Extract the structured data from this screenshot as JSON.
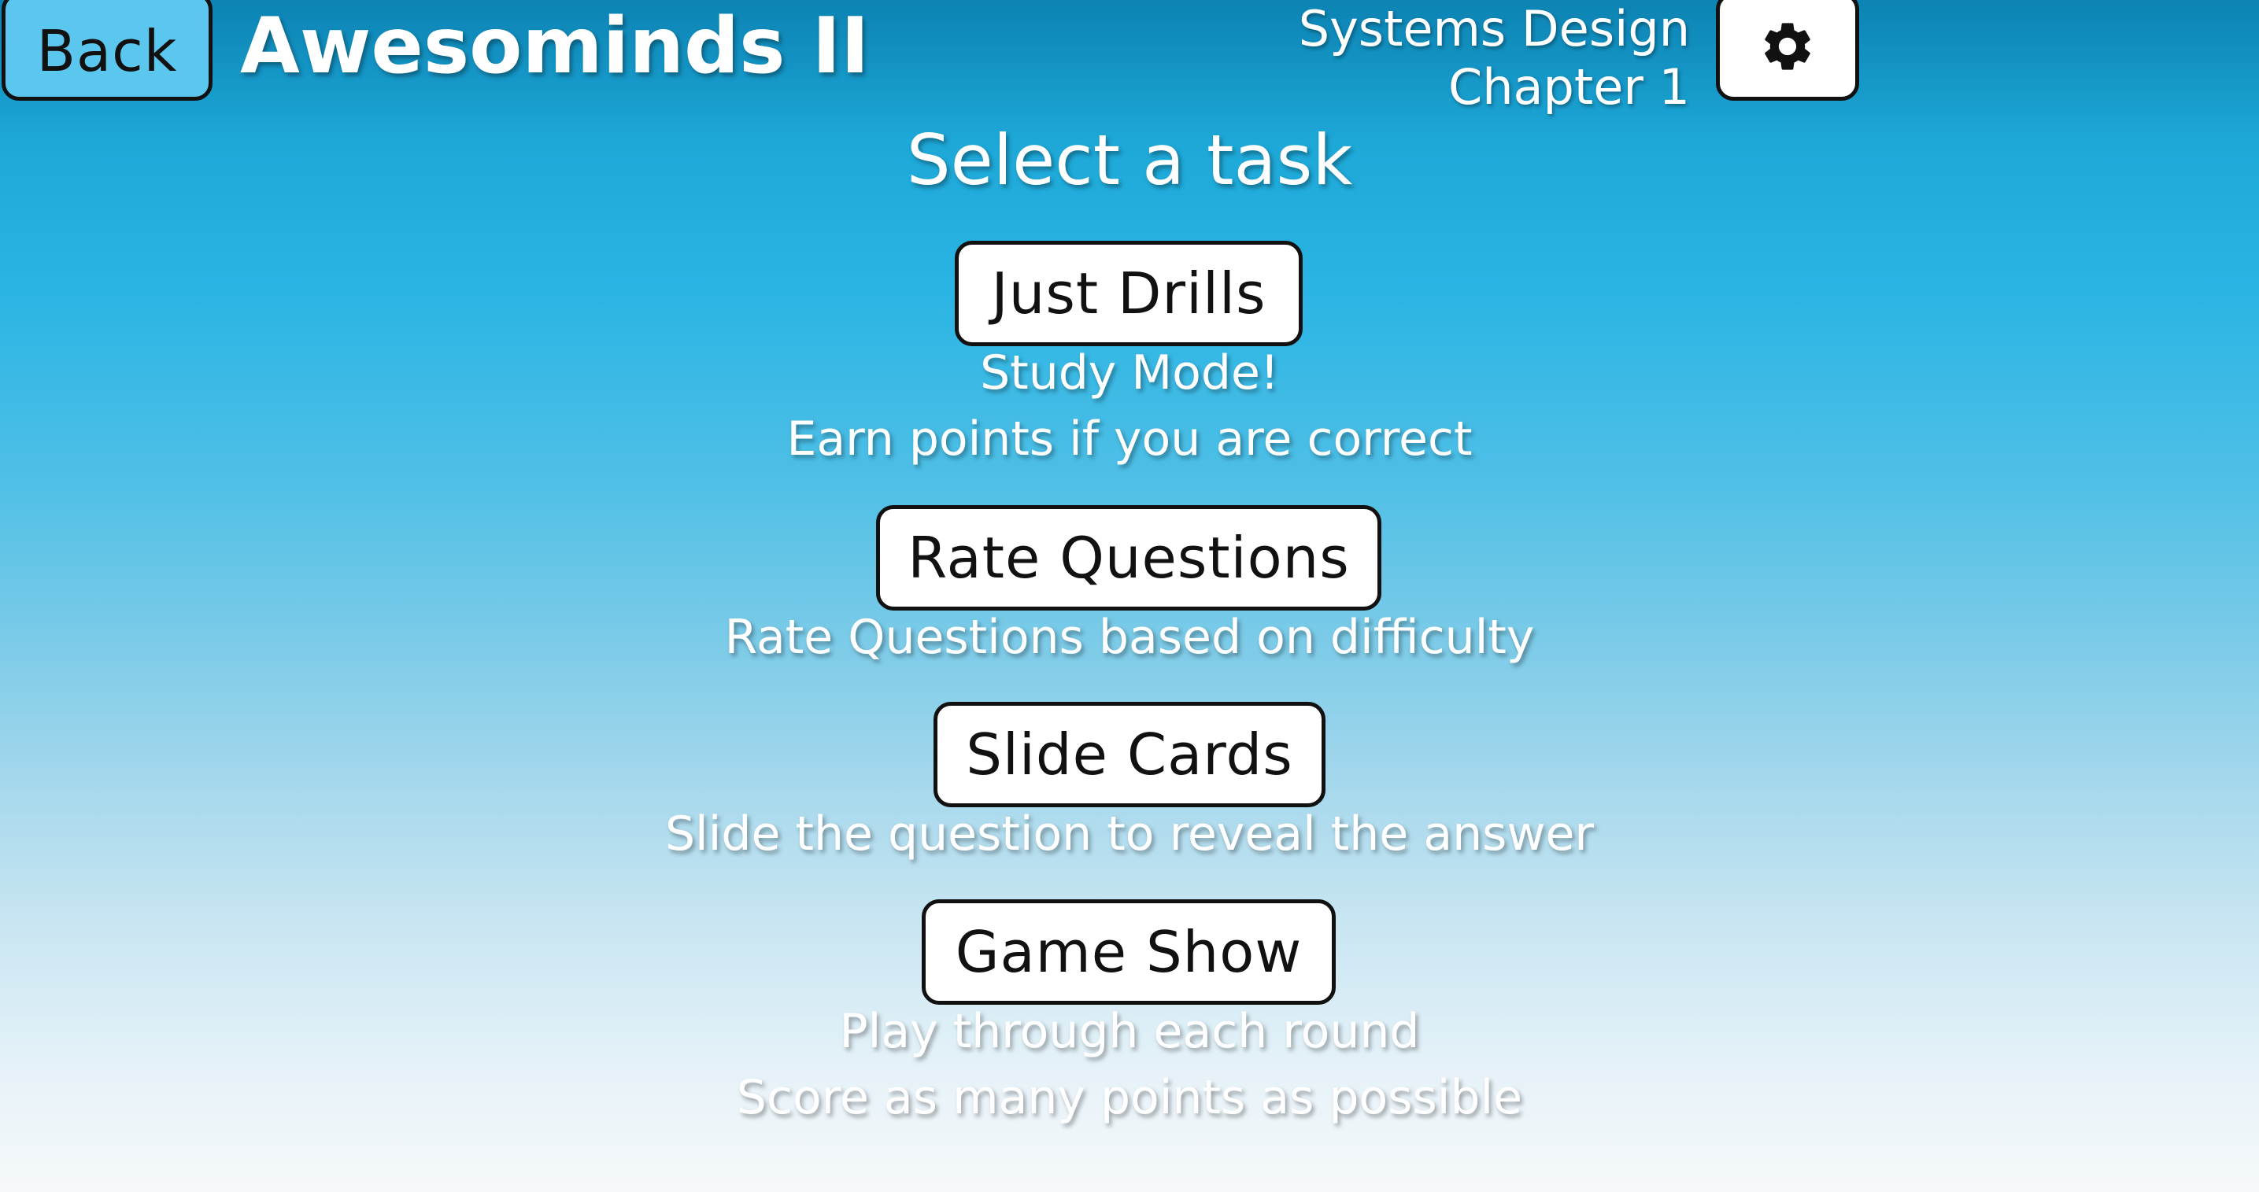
{
  "header": {
    "back_label": "Back",
    "app_title": "Awesominds II",
    "course_line1": "Systems Design",
    "course_line2": "Chapter 1",
    "settings_icon": "gear-icon"
  },
  "main": {
    "heading": "Select a task",
    "tasks": [
      {
        "label": "Just Drills",
        "description": [
          "Study Mode!",
          "Earn points if you are correct"
        ]
      },
      {
        "label": "Rate Questions",
        "description": [
          "Rate Questions based on difficulty"
        ]
      },
      {
        "label": "Slide Cards",
        "description": [
          "Slide the question to reveal the answer"
        ]
      },
      {
        "label": "Game Show",
        "description": [
          "Play through each round",
          "Score as many points as possible"
        ]
      }
    ]
  },
  "colors": {
    "background_top": "#0c83b3",
    "background_mid": "#29b4e4",
    "background_bottom": "#f6f9fb",
    "back_button": "#5bc6ee",
    "button": "#ffffff",
    "button_border": "#111111",
    "text_light": "#ffffff"
  }
}
